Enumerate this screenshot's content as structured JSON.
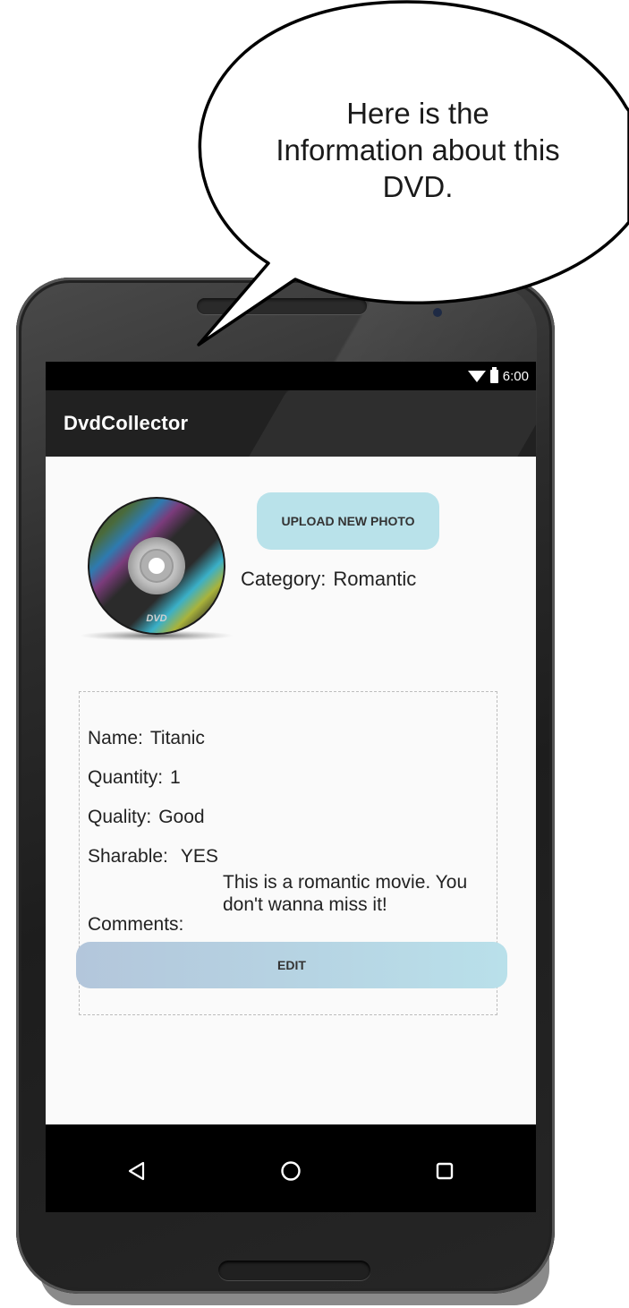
{
  "bubble": {
    "line1": "Here is the",
    "line2": "Information about this",
    "line3": "DVD."
  },
  "status_bar": {
    "time": "6:00"
  },
  "app": {
    "title": "DvdCollector"
  },
  "photo": {
    "icon": "dvd-disc-icon",
    "disc_label": "DVD",
    "upload_label": "UPLOAD NEW PHOTO"
  },
  "category": {
    "label": "Category:",
    "value": "Romantic"
  },
  "info": {
    "name_label": "Name:",
    "name_value": "Titanic",
    "quantity_label": "Quantity:",
    "quantity_value": "1",
    "quality_label": "Quality:",
    "quality_value": "Good",
    "sharable_label": "Sharable:",
    "sharable_value": "YES",
    "comments_label": "Comments:",
    "comments_value": "This is a romantic movie. You don't wanna miss it!"
  },
  "actions": {
    "edit_label": "EDIT"
  },
  "nav": {
    "back": "back-triangle-icon",
    "home": "home-circle-icon",
    "recents": "recents-square-icon"
  },
  "colors": {
    "upload_button": "#b9e2ea",
    "edit_gradient_start": "#b3c6db",
    "edit_gradient_end": "#b9e0ea",
    "action_bar": "#212121"
  }
}
